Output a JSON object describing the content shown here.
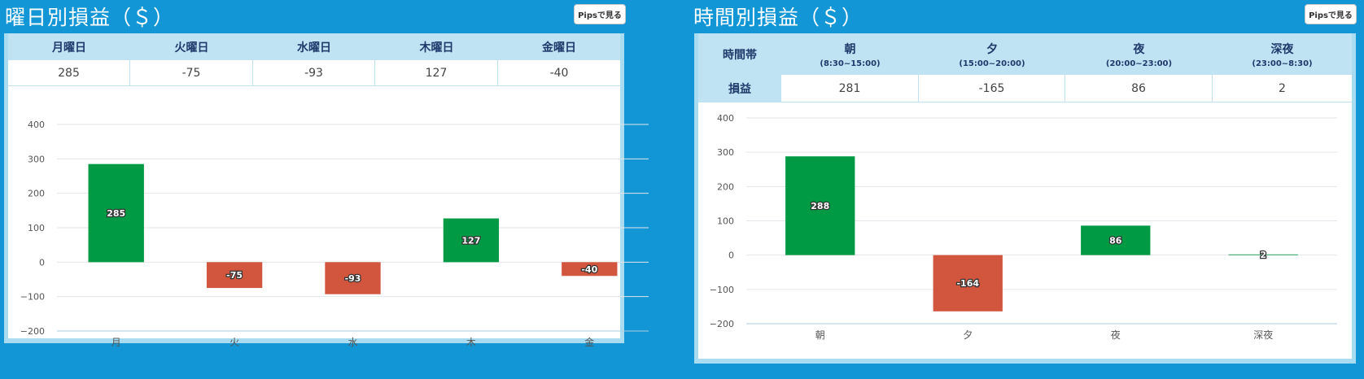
{
  "panel1": {
    "title": "曜日別損益（＄）",
    "button": "Pipsで見る",
    "days": [
      {
        "label": "月曜日",
        "value": "285"
      },
      {
        "label": "火曜日",
        "value": "-75"
      },
      {
        "label": "水曜日",
        "value": "-93"
      },
      {
        "label": "木曜日",
        "value": "127"
      },
      {
        "label": "金曜日",
        "value": "-40"
      }
    ]
  },
  "panel2": {
    "title": "時間別損益（＄）",
    "button": "Pipsで見る",
    "row_header": "時間帯",
    "row_label": "損益",
    "periods": [
      {
        "label": "朝",
        "range": "(8:30~15:00)",
        "value": "281"
      },
      {
        "label": "夕",
        "range": "(15:00~20:00)",
        "value": "-165"
      },
      {
        "label": "夜",
        "range": "(20:00~23:00)",
        "value": "86"
      },
      {
        "label": "深夜",
        "range": "(23:00~8:30)",
        "value": "2"
      }
    ]
  },
  "colors": {
    "positive": "#009a44",
    "negative": "#d2563e",
    "background": "#1396d6",
    "header": "#bfe3f2"
  },
  "chart_data": [
    {
      "type": "bar",
      "categories": [
        "月",
        "火",
        "水",
        "木",
        "金"
      ],
      "values": [
        285,
        -75,
        -93,
        127,
        -40
      ],
      "data_labels": [
        "285",
        "-75",
        "-93",
        "127",
        "-40"
      ],
      "ylim": [
        -200,
        400
      ],
      "yticks": [
        400,
        300,
        200,
        100,
        0,
        -100,
        -200
      ],
      "ytick_labels": [
        "400",
        "300",
        "200",
        "100",
        "0",
        "−100",
        "−200"
      ],
      "grid": true
    },
    {
      "type": "bar",
      "categories": [
        "朝",
        "夕",
        "夜",
        "深夜"
      ],
      "values": [
        288,
        -164,
        86,
        2
      ],
      "data_labels": [
        "288",
        "-164",
        "86",
        "2"
      ],
      "ylim": [
        -200,
        400
      ],
      "yticks": [
        400,
        300,
        200,
        100,
        0,
        -100,
        -200
      ],
      "ytick_labels": [
        "400",
        "300",
        "200",
        "100",
        "0",
        "−100",
        "−200"
      ],
      "grid": true
    }
  ]
}
